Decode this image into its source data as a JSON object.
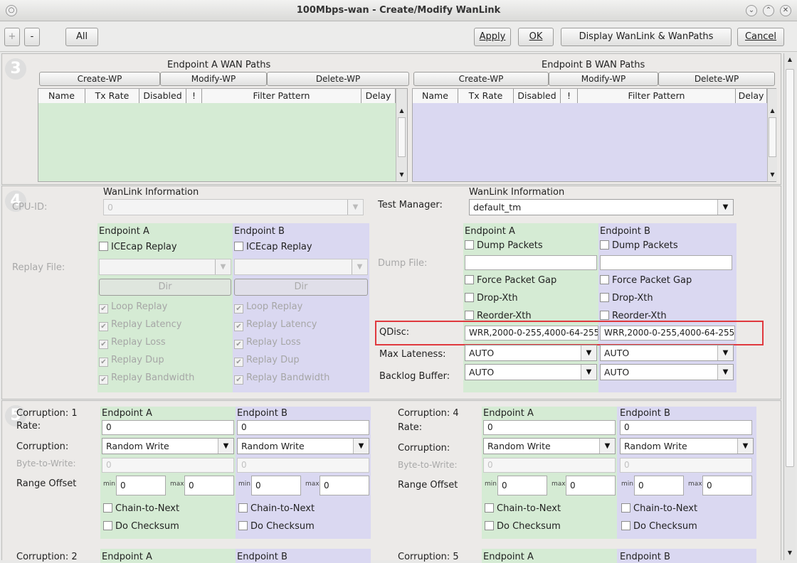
{
  "window": {
    "title": "100Mbps-wan - Create/Modify WanLink"
  },
  "toolbar": {
    "plus": "+",
    "minus": "-",
    "all": "All",
    "apply": "Apply",
    "ok": "OK",
    "display": "Display WanLink & WanPaths",
    "cancel": "Cancel"
  },
  "wan_paths": {
    "a": {
      "title": "Endpoint A WAN Paths",
      "create": "Create-WP",
      "modify": "Modify-WP",
      "delete": "Delete-WP"
    },
    "b": {
      "title": "Endpoint B WAN Paths",
      "create": "Create-WP",
      "modify": "Modify-WP",
      "delete": "Delete-WP"
    },
    "columns": [
      "Name",
      "Tx Rate",
      "Disabled",
      "!",
      "Filter Pattern",
      "Delay"
    ]
  },
  "info": {
    "header_left": "WanLink Information",
    "header_right": "WanLink Information",
    "cpu_id_label": "CPU-ID:",
    "cpu_id_value": "0",
    "test_manager_label": "Test Manager:",
    "test_manager_value": "default_tm",
    "endpoint_a": "Endpoint A",
    "endpoint_b": "Endpoint B",
    "icecap_replay": "ICEcap Replay",
    "replay_file_label": "Replay File:",
    "dir": "Dir",
    "loop_replay": "Loop Replay",
    "replay_latency": "Replay Latency",
    "replay_loss": "Replay Loss",
    "replay_dup": "Replay Dup",
    "replay_bandwidth": "Replay Bandwidth",
    "dump_packets": "Dump Packets",
    "dump_file_label": "Dump File:",
    "force_packet_gap": "Force Packet Gap",
    "drop_xth": "Drop-Xth",
    "reorder_xth": "Reorder-Xth",
    "qdisc_label": "QDisc:",
    "qdisc_a": "WRR,2000-0-255,4000-64-255",
    "qdisc_b": "WRR,2000-0-255,4000-64-255",
    "max_lateness_label": "Max Lateness:",
    "max_lateness_a": "AUTO",
    "max_lateness_b": "AUTO",
    "backlog_label": "Backlog Buffer:",
    "backlog_a": "AUTO",
    "backlog_b": "AUTO"
  },
  "corruption": {
    "c1": "Corruption: 1",
    "c4": "Corruption: 4",
    "c2": "Corruption: 2",
    "c5": "Corruption: 5",
    "rate_label": "Rate:",
    "corruption_label": "Corruption:",
    "byte_label": "Byte-to-Write:",
    "range_label": "Range Offset",
    "endpoint_a": "Endpoint A",
    "endpoint_b": "Endpoint B",
    "rate_value": "0",
    "mode": "Random Write",
    "byte_value": "0",
    "min": "min",
    "max": "max",
    "min_value": "0",
    "max_value": "0",
    "chain": "Chain-to-Next",
    "checksum": "Do Checksum"
  },
  "section_badges": {
    "s3": "3",
    "s4": "4",
    "s5": "5"
  },
  "colors": {
    "endpoint_a_bg": "#d5ebd4",
    "endpoint_b_bg": "#dad8f1",
    "highlight": "#e0393e"
  }
}
